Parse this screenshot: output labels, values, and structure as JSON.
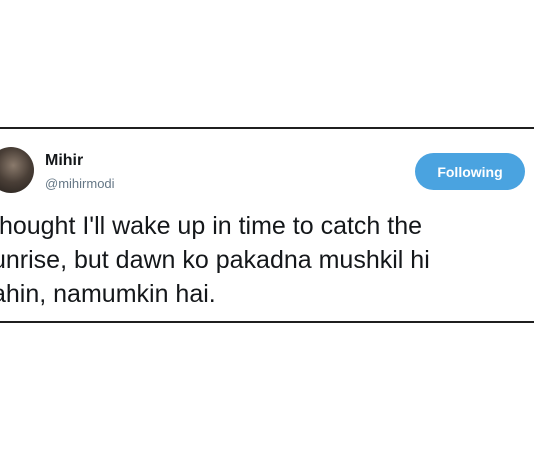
{
  "tweet": {
    "author_name": "Mihir",
    "author_handle": "@mihirmodi",
    "follow_button_label": "Following",
    "text_lines": [
      "thought I'll wake up in time to catch the",
      "unrise, but dawn ko pakadna mushkil hi",
      "ahin, namumkin hai."
    ]
  },
  "colors": {
    "follow_button": "#4aa3e0",
    "name_text": "#14171a",
    "handle_text": "#657786",
    "border": "#1f1f1f"
  }
}
